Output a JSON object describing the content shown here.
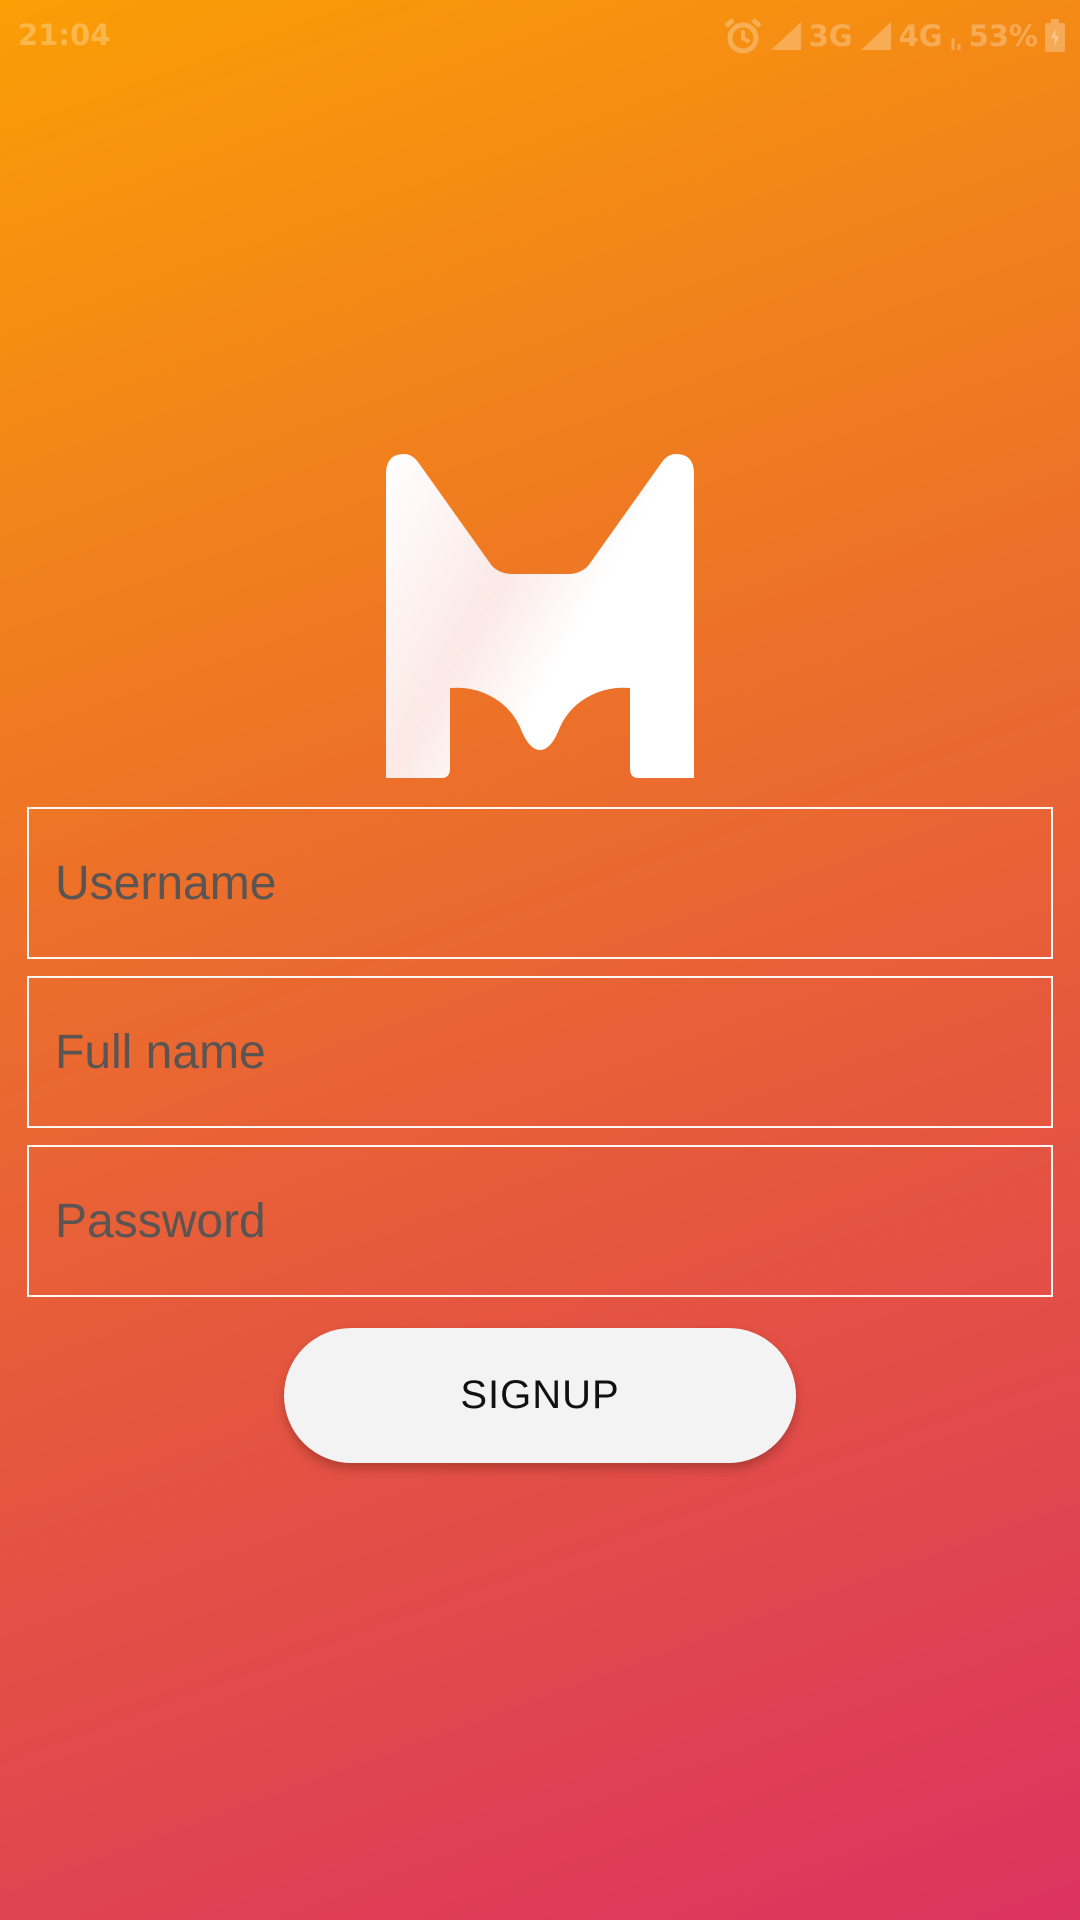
{
  "status_bar": {
    "time": "21:04",
    "network_1": "3G",
    "network_2": "4G",
    "battery": "53%",
    "icons": [
      "alarm-icon",
      "signal-icon",
      "signal-icon",
      "data-activity-icon",
      "battery-charging-icon"
    ]
  },
  "logo": {
    "icon": "m-logo-icon"
  },
  "form": {
    "username_placeholder": "Username",
    "fullname_placeholder": "Full name",
    "password_placeholder": "Password"
  },
  "signup_label": "SIGNUP",
  "colors": {
    "gradient_start": "#fa9e05",
    "gradient_end": "#dc3360",
    "button_bg": "#f3f3f3",
    "placeholder": "#5a5452"
  }
}
